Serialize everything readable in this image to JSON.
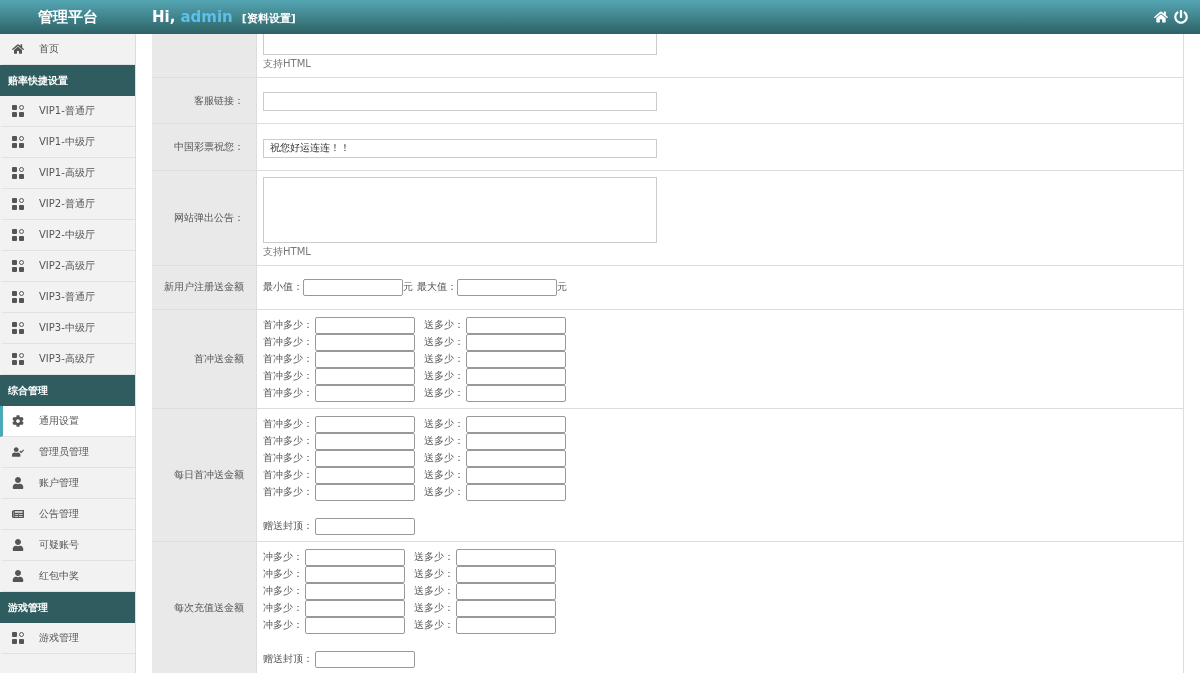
{
  "header": {
    "brand": "管理平台",
    "greeting": "Hi,",
    "user": "admin",
    "profile_link": "[资料设置]"
  },
  "sidebar": [
    {
      "kind": "home",
      "label": "首页",
      "selected": false
    },
    {
      "kind": "section",
      "label": "赔率快捷设置"
    },
    {
      "kind": "apps",
      "label": "VIP1-普通厅",
      "selected": false
    },
    {
      "kind": "apps",
      "label": "VIP1-中级厅",
      "selected": false
    },
    {
      "kind": "apps",
      "label": "VIP1-高级厅",
      "selected": false
    },
    {
      "kind": "apps",
      "label": "VIP2-普通厅",
      "selected": false
    },
    {
      "kind": "apps",
      "label": "VIP2-中级厅",
      "selected": false
    },
    {
      "kind": "apps",
      "label": "VIP2-高级厅",
      "selected": false
    },
    {
      "kind": "apps",
      "label": "VIP3-普通厅",
      "selected": false
    },
    {
      "kind": "apps",
      "label": "VIP3-中级厅",
      "selected": false
    },
    {
      "kind": "apps",
      "label": "VIP3-高级厅",
      "selected": false
    },
    {
      "kind": "section",
      "label": "综合管理"
    },
    {
      "kind": "settings",
      "label": "通用设置",
      "selected": true
    },
    {
      "kind": "admin",
      "label": "管理员管理",
      "selected": false
    },
    {
      "kind": "user",
      "label": "账户管理",
      "selected": false
    },
    {
      "kind": "notice",
      "label": "公告管理",
      "selected": false
    },
    {
      "kind": "user",
      "label": "可疑账号",
      "selected": false
    },
    {
      "kind": "user",
      "label": "红包中奖",
      "selected": false
    },
    {
      "kind": "section",
      "label": "游戏管理"
    },
    {
      "kind": "apps",
      "label": "游戏管理",
      "selected": false
    }
  ],
  "form_rows": [
    {
      "kind": "textarea",
      "cut": true,
      "hint": "支持HTML"
    },
    {
      "kind": "input",
      "label": "客服链接："
    },
    {
      "kind": "input",
      "label": "中国彩票祝您：",
      "value": "祝您好运连连！！"
    },
    {
      "kind": "textarea",
      "label": "网站弹出公告：",
      "hint": "支持HTML"
    },
    {
      "kind": "range",
      "label": "新用户注册送金额",
      "min_label": "最小值：",
      "min_unit": "元",
      "max_label": "最大值：",
      "max_unit": "元"
    },
    {
      "kind": "pairs",
      "label": "首冲送金额",
      "pairs": [
        {
          "left": "首冲多少：",
          "right": "送多少："
        },
        {
          "left": "首冲多少：",
          "right": "送多少："
        },
        {
          "left": "首冲多少：",
          "right": "送多少："
        },
        {
          "left": "首冲多少：",
          "right": "送多少："
        },
        {
          "left": "首冲多少：",
          "right": "送多少："
        }
      ]
    },
    {
      "kind": "pairs",
      "label": "每日首冲送金额",
      "pairs": [
        {
          "left": "首冲多少：",
          "right": "送多少："
        },
        {
          "left": "首冲多少：",
          "right": "送多少："
        },
        {
          "left": "首冲多少：",
          "right": "送多少："
        },
        {
          "left": "首冲多少：",
          "right": "送多少："
        },
        {
          "left": "首冲多少：",
          "right": "送多少："
        }
      ],
      "cap_label": "赠送封顶："
    },
    {
      "kind": "pairs",
      "label": "每次充值送金额",
      "pairs": [
        {
          "left": "冲多少：",
          "right": "送多少："
        },
        {
          "left": "冲多少：",
          "right": "送多少："
        },
        {
          "left": "冲多少：",
          "right": "送多少："
        },
        {
          "left": "冲多少：",
          "right": "送多少："
        },
        {
          "left": "冲多少：",
          "right": "送多少："
        }
      ],
      "cap_label": "赠送封顶："
    }
  ]
}
